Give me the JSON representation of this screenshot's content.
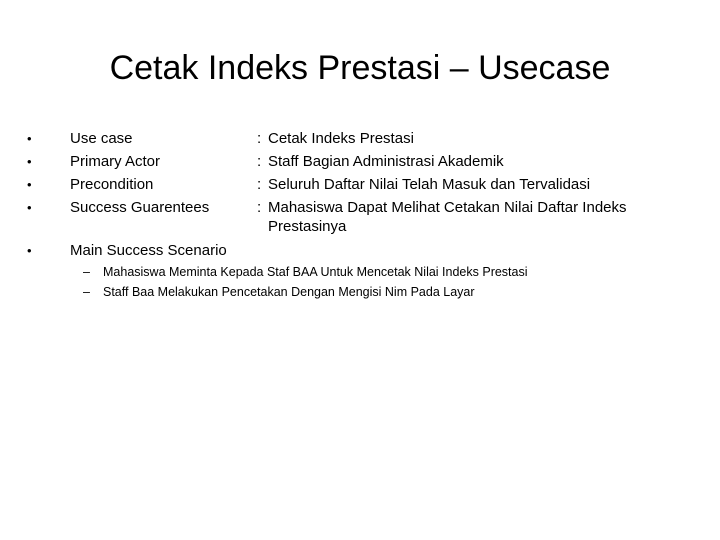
{
  "slide": {
    "title": "Cetak Indeks Prestasi – Usecase",
    "bullet_glyph": "•",
    "dash_glyph": "–",
    "fields": [
      {
        "label": "Use case",
        "colon": ":",
        "value": "Cetak Indeks Prestasi",
        "value_cont": ""
      },
      {
        "label": "Primary Actor",
        "colon": ":",
        "value": "Staff Bagian Administrasi Akademik",
        "value_cont": ""
      },
      {
        "label": "Precondition",
        "colon": ":",
        "value": "Seluruh Daftar Nilai Telah Masuk dan Tervalidasi",
        "value_cont": ""
      },
      {
        "label": "Success Guarentees",
        "colon": ":",
        "value": "Mahasiswa Dapat Melihat Cetakan Nilai Daftar Indeks",
        "value_cont": "Prestasinya"
      }
    ],
    "main_scenario": {
      "label": "Main Success Scenario",
      "steps": [
        "Mahasiswa Meminta Kepada Staf BAA Untuk Mencetak Nilai Indeks Prestasi",
        "Staff Baa Melakukan Pencetakan Dengan Mengisi Nim Pada Layar"
      ]
    }
  }
}
